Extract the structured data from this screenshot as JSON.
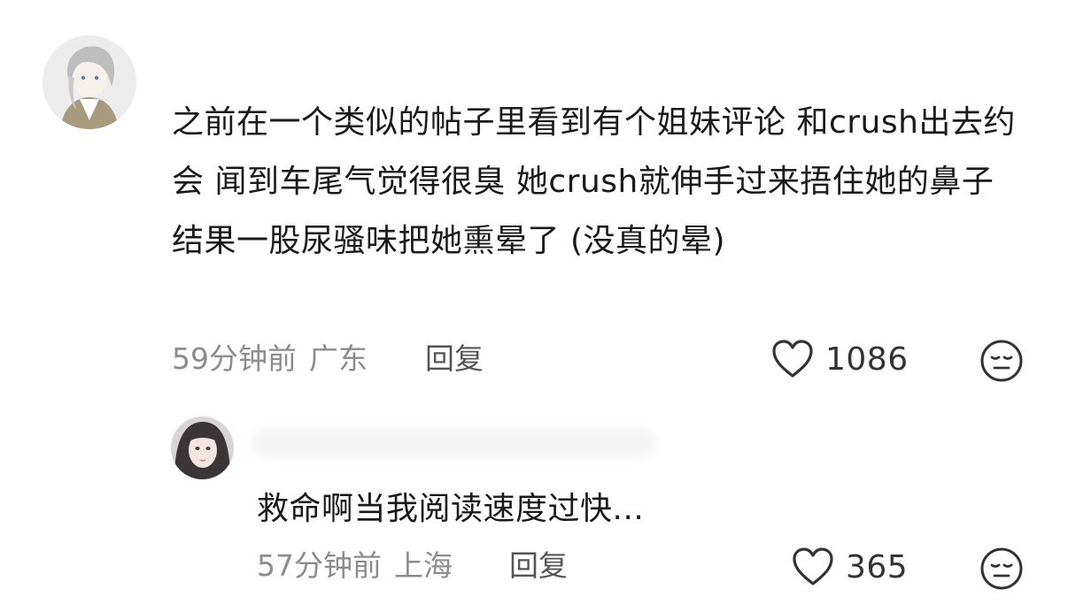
{
  "comments": [
    {
      "text": "之前在一个类似的帖子里看到有个姐妹评论 和crush出去约会 闻到车尾气觉得很臭 她crush就伸手过来捂住她的鼻子 结果一股尿骚味把她熏晕了 (没真的晕)",
      "time": "59分钟前",
      "location": "广东",
      "reply_label": "回复",
      "like_count": "1086",
      "icons": {
        "like": "heart-icon",
        "reaction": "meh-face-icon"
      }
    },
    {
      "text": "救命啊当我阅读速度过快...",
      "time": "57分钟前",
      "location": "上海",
      "reply_label": "回复",
      "like_count": "365",
      "icons": {
        "like": "heart-icon",
        "reaction": "meh-face-icon"
      }
    }
  ],
  "colors": {
    "text": "#1a1a1a",
    "meta": "#8c8c8c",
    "reply": "#555555",
    "icon": "#333333"
  }
}
